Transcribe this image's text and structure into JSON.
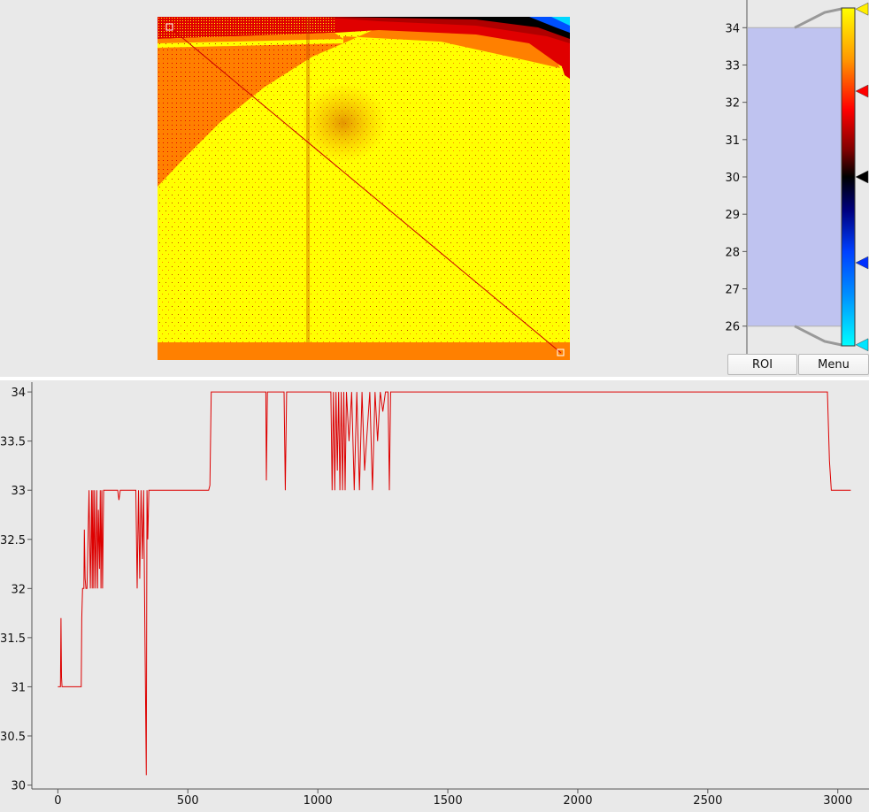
{
  "image_view": {
    "colors": {
      "yellow": "#ffff00",
      "orange": "#ff8000",
      "red": "#e00000",
      "darkred": "#a00000",
      "black": "#000000",
      "cyan": "#00d8ff"
    },
    "roi_line_color": "#cc0000"
  },
  "histogram": {
    "ticks": [
      "34",
      "33",
      "32",
      "31",
      "30",
      "29",
      "28",
      "27",
      "26"
    ],
    "range": [
      25.4,
      34.6
    ],
    "selection": [
      26.0,
      34.0
    ],
    "fill_color": "#bfc3f0",
    "markers": [
      {
        "value": 34.5,
        "color": "#ffee00"
      },
      {
        "value": 32.3,
        "color": "#ff0000"
      },
      {
        "value": 30.0,
        "color": "#000000"
      },
      {
        "value": 27.7,
        "color": "#0030ff"
      },
      {
        "value": 25.5,
        "color": "#00e5ff"
      }
    ]
  },
  "buttons": {
    "roi": "ROI",
    "menu": "Menu"
  },
  "profile": {
    "line_color": "#dd0000",
    "y_ticks": [
      "34",
      "33.5",
      "33",
      "32.5",
      "32",
      "31.5",
      "31",
      "30.5",
      "30"
    ],
    "x_ticks": [
      "0",
      "500",
      "1000",
      "1500",
      "2000",
      "2500",
      "3000"
    ],
    "chart_data": {
      "type": "line",
      "xlim": [
        -100,
        3120
      ],
      "ylim": [
        29.96,
        34.1
      ],
      "x": [
        0,
        10,
        12,
        14,
        16,
        18,
        30,
        90,
        92,
        95,
        100,
        102,
        105,
        108,
        112,
        120,
        125,
        130,
        132,
        135,
        138,
        141,
        145,
        150,
        153,
        156,
        160,
        163,
        166,
        169,
        172,
        176,
        180,
        185,
        230,
        235,
        240,
        300,
        305,
        310,
        315,
        320,
        325,
        330,
        335,
        340,
        343,
        346,
        350,
        355,
        360,
        400,
        580,
        585,
        590,
        595,
        600,
        800,
        802,
        806,
        810,
        870,
        875,
        880,
        1050,
        1055,
        1060,
        1065,
        1070,
        1075,
        1080,
        1085,
        1090,
        1095,
        1100,
        1105,
        1110,
        1120,
        1130,
        1140,
        1150,
        1160,
        1170,
        1180,
        1200,
        1210,
        1220,
        1230,
        1240,
        1250,
        1260,
        1270,
        1275,
        1280,
        1290,
        2960,
        2968,
        2975,
        3050
      ],
      "y": [
        31,
        31,
        31.7,
        31.1,
        31,
        31,
        31,
        31,
        31.7,
        32,
        32,
        32.6,
        32.1,
        32,
        32,
        33,
        32,
        33,
        32,
        33,
        32,
        33,
        32,
        33,
        32,
        32.8,
        32.2,
        33,
        32,
        33,
        32,
        33,
        33,
        33,
        33,
        32.9,
        33,
        33,
        32,
        33,
        32.1,
        33,
        32.3,
        33,
        31.5,
        30.1,
        33,
        32.5,
        33,
        33,
        33,
        33,
        33,
        33.05,
        34,
        34,
        34,
        34,
        33.1,
        34,
        34,
        34,
        33,
        34,
        34,
        33,
        34,
        33,
        34,
        33.2,
        34,
        33,
        34,
        33,
        34,
        33,
        34,
        33.5,
        34,
        33,
        34,
        33,
        34,
        33.2,
        34,
        33,
        34,
        33.5,
        34,
        33.8,
        34,
        34,
        33,
        34,
        34,
        34,
        33.3,
        33,
        33
      ]
    }
  }
}
